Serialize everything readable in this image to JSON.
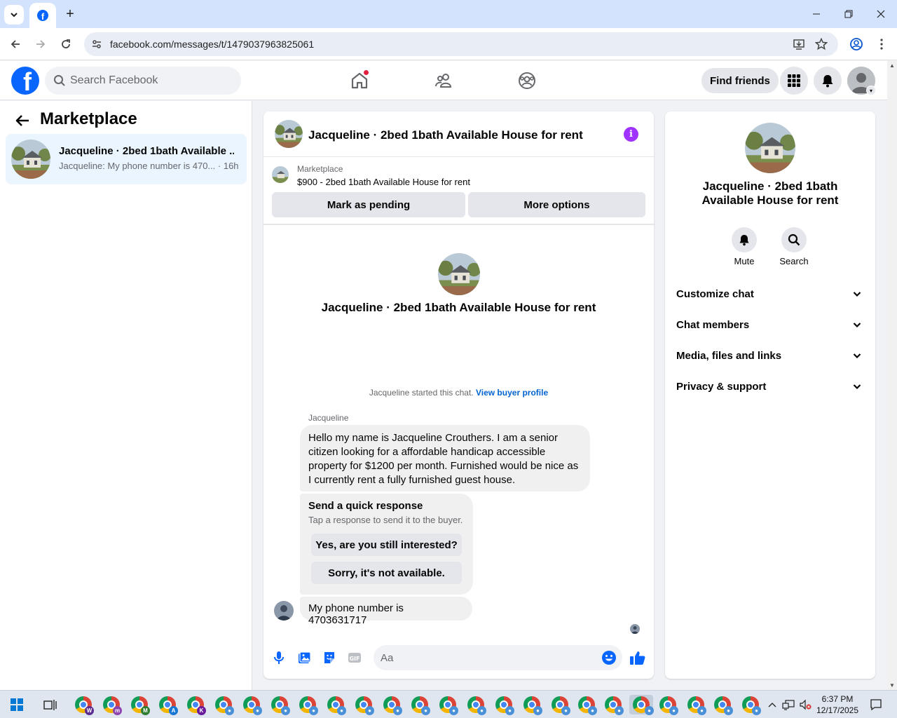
{
  "browser": {
    "url": "facebook.com/messages/t/1479037963825061",
    "tab_icon": "facebook-icon"
  },
  "fb": {
    "search_placeholder": "Search Facebook",
    "find_friends": "Find friends"
  },
  "left": {
    "title": "Marketplace",
    "conversation": {
      "name": "Jacqueline · 2bed 1bath Available ...",
      "snippet": "Jacqueline: My phone number is 470... · 16h"
    }
  },
  "chat": {
    "header_title": "Jacqueline · 2bed 1bath Available House for rent",
    "listing": {
      "kicker": "Marketplace",
      "title": "$900 - 2bed 1bath Available House for rent",
      "btn_pending": "Mark as pending",
      "btn_more": "More options"
    },
    "intro_name": "Jacqueline · 2bed 1bath Available House for rent",
    "started_text": "Jacqueline started this chat. ",
    "started_link": "View buyer profile",
    "sender": "Jacqueline",
    "message1": "Hello my name is Jacqueline Crouthers.  I am a senior citizen looking for a affordable handicap accessible property for  $1200 per month.  Furnished would be nice as I currently rent a fully furnished guest house.",
    "quick": {
      "title": "Send a quick response",
      "subtitle": "Tap a response to send it to the buyer.",
      "option1": "Yes, are you still interested?",
      "option2": "Sorry, it's not available."
    },
    "message3": "My phone number is 4703631717",
    "composer_placeholder": "Aa"
  },
  "right": {
    "name": "Jacqueline · 2bed 1bath Available House for rent",
    "mute": "Mute",
    "search": "Search",
    "rows": [
      "Customize chat",
      "Chat members",
      "Media, files and links",
      "Privacy & support"
    ]
  },
  "taskbar": {
    "time": "6:37 PM",
    "date": "12/17/2025"
  },
  "colors": {
    "fb_blue": "#0866ff",
    "link": "#0064d1",
    "info_purple": "#a033ff",
    "notif_red": "#e41e3f"
  }
}
